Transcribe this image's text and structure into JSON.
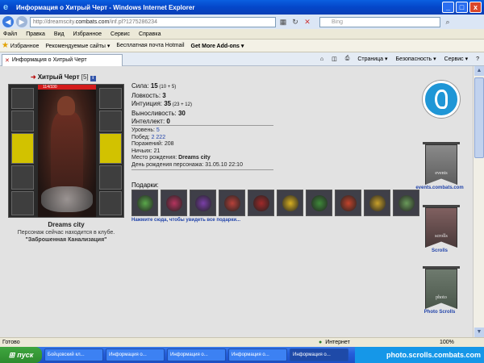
{
  "window": {
    "title": "Информация о Хитрый Черт - Windows Internet Explorer",
    "minimize": "_",
    "maximize": "□",
    "close": "x"
  },
  "address": {
    "url_prefix": "http://dreamscity.",
    "url_domain": "combats.com",
    "url_path": "/inf.pl?1275286234",
    "search_placeholder": "Bing"
  },
  "menu": [
    "Файл",
    "Правка",
    "Вид",
    "Избранное",
    "Сервис",
    "Справка"
  ],
  "favorites": {
    "label": "Избранное",
    "items": [
      "Рекомендуемые сайты ▾",
      "Бесплатная почта Hotmail",
      "Get More Add-ons ▾"
    ]
  },
  "tab": {
    "label": "Информация о Хитрый Черт"
  },
  "commands": [
    "Страница ▾",
    "Безопасность ▾",
    "Сервис ▾"
  ],
  "character": {
    "name": "Хитрый Черт",
    "level": "[5]",
    "hp": "114/330",
    "city": "Dreams city",
    "location_text": "Персонаж сейчас находится в клубе.",
    "location_name": "\"Заброшенная Канализация\""
  },
  "stats": [
    {
      "label": "Сила: ",
      "value": "15",
      "extra": " (10 + 5)"
    },
    {
      "label": "Ловкость: ",
      "value": "3",
      "extra": ""
    },
    {
      "label": "Интуиция: ",
      "value": "35",
      "extra": " (23 + 12)"
    },
    {
      "label": "Выносливость: ",
      "value": "30",
      "extra": ""
    },
    {
      "label": "Интеллект: ",
      "value": "0",
      "extra": ""
    }
  ],
  "info": {
    "level_label": "Уровень: ",
    "level": "5",
    "wins_label": "Побед: ",
    "wins": "2 222",
    "losses_label": "Поражений: ",
    "losses": "208",
    "draws_label": "Ничьих: ",
    "draws": "21",
    "birthplace_label": "Место рождения: ",
    "birthplace": "Dreams city",
    "birthday_label": "День рождения персонажа: ",
    "birthday": "31.05.10 22:10"
  },
  "gifts": {
    "title": "Подарки:",
    "link": "Нажмите сюда, чтобы увидеть все подарки...",
    "items": [
      "#5aa84a",
      "#b5345e",
      "#7a3fa8",
      "#b8413a",
      "#a02a2a",
      "#d8b021",
      "#3f8a3a",
      "#c2432b",
      "#c8a02a",
      "#6a9a5a"
    ]
  },
  "banners": [
    {
      "text": "events",
      "label": "events.combats.com"
    },
    {
      "text": "scrolls",
      "label": "Scrolls"
    },
    {
      "text": "photo",
      "label": "Photo Scrolls"
    }
  ],
  "status": {
    "text": "Готово",
    "zone": "Интернет",
    "zoom": "100%"
  },
  "taskbar": {
    "start": "пуск",
    "tasks": [
      "Бойцовский кл...",
      "Информация о...",
      "Информация о...",
      "Информация о...",
      "Информация о...",
      "Информация о..."
    ],
    "tray": "photo.scrolls.combats.com"
  }
}
